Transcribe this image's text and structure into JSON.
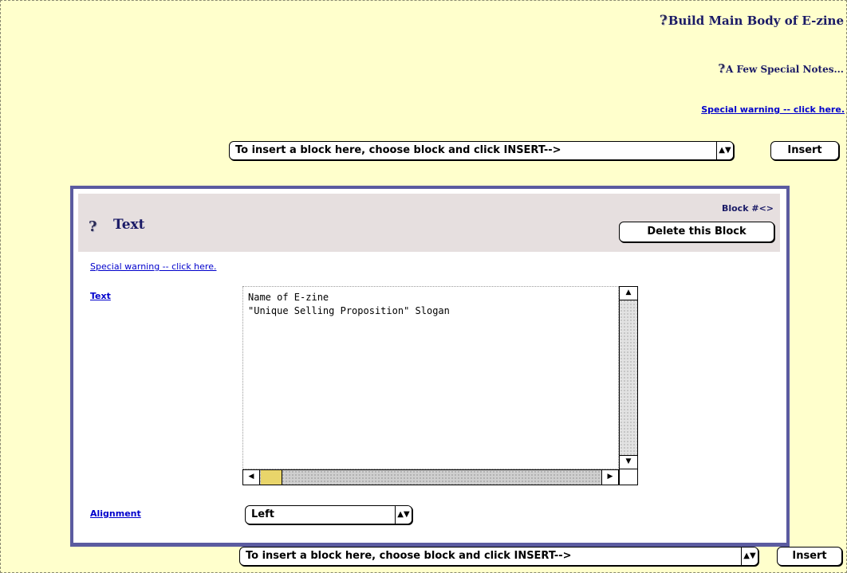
{
  "header": {
    "help_glyph": "?",
    "title": "Build Main Body of E-zine",
    "notes": "A Few Special Notes...",
    "warning_link": "Special warning -- click here."
  },
  "insert_top": {
    "select_label": "To insert a block here, choose block and click INSERT-->",
    "button_label": "Insert"
  },
  "block": {
    "help_glyph": "?",
    "title": "Text",
    "number_label": "Block #<>",
    "delete_label": "Delete this Block",
    "warning_link": "Special warning -- click here.",
    "text_field": {
      "label": "Text",
      "value": "Name of E-zine\n\"Unique Selling Proposition\" Slogan"
    },
    "alignment": {
      "label": "Alignment",
      "selected": "Left"
    }
  },
  "insert_bottom": {
    "select_label": "To insert a block here, choose block and click INSERT-->",
    "button_label": "Insert"
  },
  "colors": {
    "page_background": "#ffffcc",
    "panel_border": "#5b5ba0",
    "panel_header": "#e6dfdf",
    "heading_text": "#1a1a66",
    "link": "#0000cc",
    "scroll_thumb": "#e9d56a"
  }
}
